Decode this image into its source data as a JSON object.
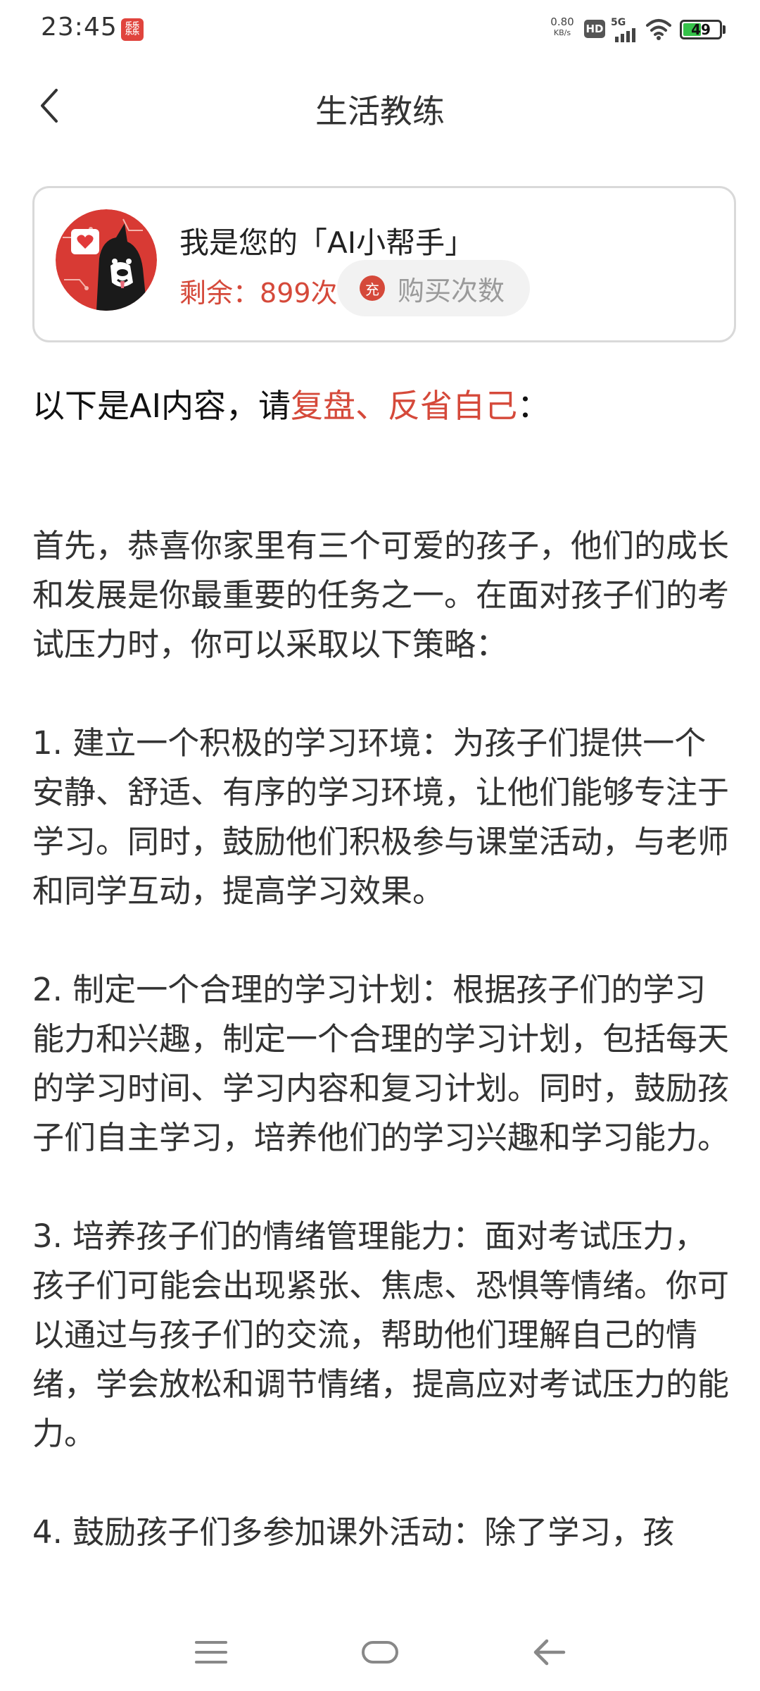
{
  "status_bar": {
    "time": "23:45",
    "app_icon_text": "乐乐\n乐乐",
    "network_speed_value": "0.80",
    "network_speed_unit": "KB/s",
    "hd_label": "HD",
    "network_type": "5G",
    "battery_level": "49",
    "battery_fill_percent": 49
  },
  "header": {
    "title": "生活教练"
  },
  "ai_card": {
    "title": "我是您的「AI小帮手」",
    "remaining_label": "剩余：",
    "remaining_count": "899次",
    "buy_icon_text": "充",
    "buy_label": "购买次数"
  },
  "intro": {
    "prefix": "以下是AI内容，请",
    "highlight": "复盘、反省自己",
    "suffix": "："
  },
  "content": {
    "paragraphs": [
      "首先，恭喜你家里有三个可爱的孩子，他们的成长和发展是你最重要的任务之一。在面对孩子们的考试压力时，你可以采取以下策略：",
      "1. 建立一个积极的学习环境：为孩子们提供一个安静、舒适、有序的学习环境，让他们能够专注于学习。同时，鼓励他们积极参与课堂活动，与老师和同学互动，提高学习效果。",
      "2. 制定一个合理的学习计划：根据孩子们的学习能力和兴趣，制定一个合理的学习计划，包括每天的学习时间、学习内容和复习计划。同时，鼓励孩子们自主学习，培养他们的学习兴趣和学习能力。",
      "3. 培养孩子们的情绪管理能力：面对考试压力，孩子们可能会出现紧张、焦虑、恐惧等情绪。你可以通过与孩子们的交流，帮助他们理解自己的情绪，学会放松和调节情绪，提高应对考试压力的能力。",
      "4. 鼓励孩子们多参加课外活动：除了学习，孩"
    ]
  },
  "colors": {
    "accent": "#d5493a",
    "text_primary": "#222222",
    "card_border": "#d9d9d9",
    "buy_button_bg": "#f2f2f2"
  },
  "icons": {
    "back": "chevron-left-icon",
    "nav_menu": "menu-icon",
    "nav_home": "home-icon",
    "nav_back": "back-arrow-icon"
  }
}
